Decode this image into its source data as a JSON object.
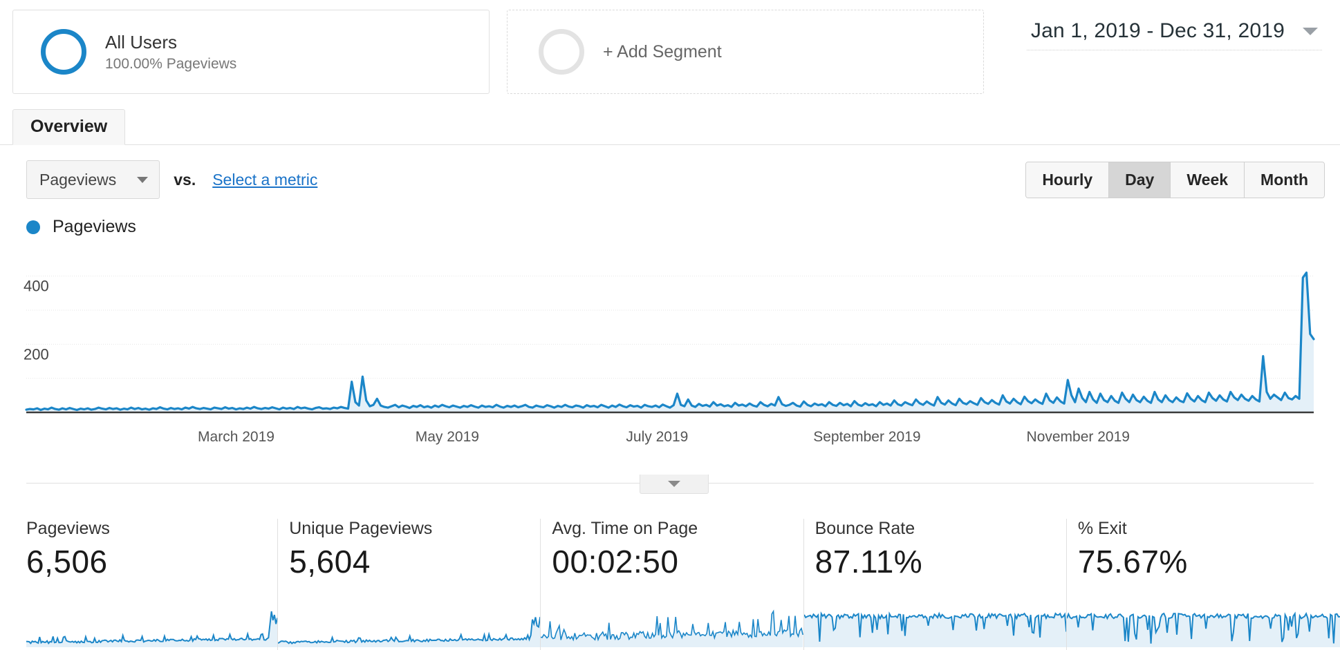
{
  "segment_bar": {
    "all_users": {
      "title": "All Users",
      "subtitle": "100.00% Pageviews",
      "ring_color": "#1b86c8"
    },
    "add_segment": {
      "label": "+ Add Segment"
    },
    "date_range": {
      "text": "Jan 1, 2019 - Dec 31, 2019"
    }
  },
  "tabs": [
    {
      "label": "Overview",
      "active": true
    }
  ],
  "controls": {
    "metric_select": {
      "value": "Pageviews"
    },
    "vs_label": "vs.",
    "select_metric_link": "Select a metric",
    "granularity": {
      "options": [
        "Hourly",
        "Day",
        "Week",
        "Month"
      ],
      "selected": "Day"
    }
  },
  "legend": {
    "label": "Pageviews",
    "color": "#1b86c8"
  },
  "cards": [
    {
      "title": "Pageviews",
      "value": "6,506",
      "spark": "flat-spike-end"
    },
    {
      "title": "Unique Pageviews",
      "value": "5,604",
      "spark": "flat-spike-end"
    },
    {
      "title": "Avg. Time on Page",
      "value": "00:02:50",
      "spark": "noisy-bars"
    },
    {
      "title": "Bounce Rate",
      "value": "87.11%",
      "spark": "high-with-drops"
    },
    {
      "title": "% Exit",
      "value": "75.67%",
      "spark": "high-with-drops"
    }
  ],
  "chart_data": {
    "type": "area",
    "title": "Pageviews",
    "xlabel": "",
    "ylabel": "Pageviews",
    "ylim": [
      0,
      450
    ],
    "yticks": [
      200,
      400
    ],
    "gridlines": [
      100,
      200,
      300,
      400
    ],
    "grid": true,
    "legend_position": "top-left",
    "line_color": "#1b86c8",
    "fill_color": "#e4f0f8",
    "xtick_labels": [
      "March 2019",
      "May 2019",
      "July 2019",
      "September 2019",
      "November 2019"
    ],
    "xtick_positions": [
      0.163,
      0.327,
      0.49,
      0.653,
      0.817
    ],
    "x_start": "Jan 1, 2019",
    "x_end": "Dec 31, 2019",
    "series": [
      {
        "name": "Pageviews",
        "values": [
          8,
          10,
          9,
          12,
          7,
          11,
          9,
          14,
          10,
          8,
          12,
          9,
          13,
          10,
          7,
          11,
          9,
          12,
          8,
          10,
          14,
          11,
          9,
          13,
          10,
          12,
          8,
          11,
          9,
          14,
          10,
          13,
          9,
          11,
          8,
          12,
          10,
          15,
          11,
          9,
          13,
          10,
          12,
          9,
          14,
          11,
          16,
          12,
          10,
          13,
          11,
          9,
          14,
          12,
          10,
          15,
          11,
          13,
          9,
          12,
          10,
          14,
          11,
          16,
          12,
          10,
          13,
          11,
          15,
          12,
          9,
          14,
          11,
          13,
          10,
          16,
          12,
          14,
          11,
          9,
          13,
          15,
          11,
          12,
          10,
          14,
          12,
          16,
          13,
          11,
          90,
          30,
          20,
          105,
          35,
          18,
          22,
          40,
          20,
          16,
          14,
          18,
          22,
          15,
          20,
          17,
          13,
          19,
          16,
          21,
          15,
          18,
          14,
          20,
          16,
          22,
          18,
          15,
          20,
          17,
          14,
          19,
          16,
          21,
          17,
          14,
          20,
          16,
          18,
          15,
          22,
          17,
          14,
          19,
          16,
          20,
          15,
          18,
          22,
          16,
          14,
          20,
          17,
          15,
          21,
          18,
          14,
          19,
          16,
          22,
          17,
          15,
          20,
          18,
          14,
          21,
          17,
          19,
          15,
          22,
          18,
          14,
          20,
          16,
          23,
          18,
          15,
          21,
          17,
          19,
          14,
          22,
          18,
          16,
          20,
          15,
          23,
          18,
          14,
          21,
          55,
          22,
          18,
          38,
          20,
          16,
          25,
          19,
          22,
          17,
          30,
          20,
          24,
          18,
          21,
          16,
          28,
          20,
          23,
          18,
          26,
          20,
          17,
          30,
          22,
          18,
          25,
          20,
          45,
          24,
          19,
          22,
          28,
          20,
          17,
          32,
          22,
          18,
          26,
          21,
          24,
          18,
          30,
          22,
          19,
          28,
          21,
          25,
          18,
          33,
          23,
          19,
          27,
          21,
          24,
          18,
          30,
          22,
          26,
          20,
          35,
          24,
          20,
          30,
          25,
          21,
          38,
          27,
          22,
          32,
          25,
          20,
          45,
          28,
          23,
          35,
          26,
          21,
          40,
          28,
          24,
          33,
          27,
          22,
          42,
          30,
          25,
          36,
          28,
          23,
          50,
          32,
          26,
          40,
          30,
          24,
          46,
          33,
          27,
          38,
          30,
          25,
          55,
          35,
          28,
          44,
          32,
          26,
          95,
          50,
          30,
          70,
          42,
          30,
          60,
          38,
          28,
          55,
          36,
          30,
          48,
          34,
          28,
          58,
          40,
          30,
          52,
          36,
          30,
          46,
          34,
          28,
          60,
          38,
          30,
          50,
          36,
          30,
          44,
          34,
          30,
          56,
          40,
          32,
          48,
          36,
          30,
          58,
          42,
          34,
          50,
          38,
          32,
          60,
          44,
          36,
          52,
          40,
          34,
          48,
          38,
          32,
          165,
          60,
          40,
          52,
          44,
          36,
          58,
          42,
          38,
          48,
          40,
          395,
          410,
          230,
          215
        ]
      }
    ]
  }
}
